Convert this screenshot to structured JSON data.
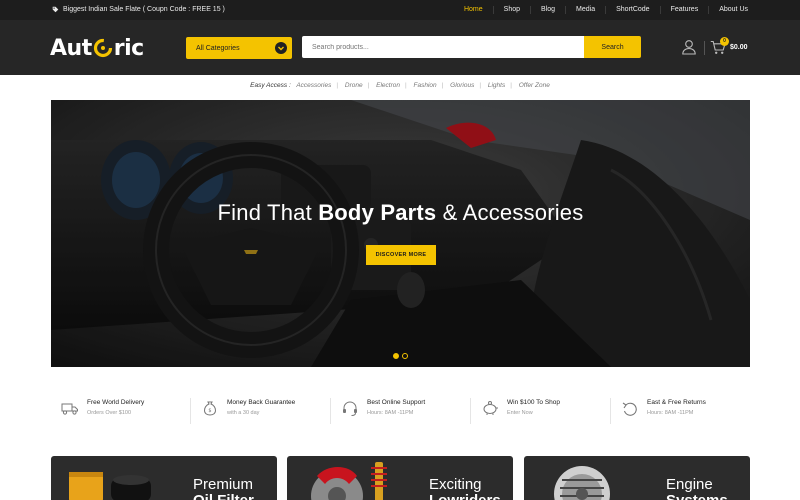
{
  "topbar": {
    "promo_text": "Biggest Indian Sale Flate ( Coupn Code : FREE 15 )",
    "nav": [
      "Home",
      "Shop",
      "Blog",
      "Media",
      "ShortCode",
      "Features",
      "About Us"
    ],
    "active_nav": "Home"
  },
  "header": {
    "logo_left": "Aut",
    "logo_right": "ric",
    "category_select": "All Categories",
    "search_placeholder": "Search products...",
    "search_button": "Search",
    "cart_count": "0",
    "cart_total": "$0.00"
  },
  "easy_access": {
    "label": "Easy Access :",
    "links": [
      "Accessories",
      "Drone",
      "Electron",
      "Fashion",
      "Glorious",
      "Lights",
      "Offer Zone"
    ]
  },
  "hero": {
    "title_pre": "Find That ",
    "title_bold": "Body Parts",
    "title_post": " & Accessories",
    "button": "DISCOVER MORE",
    "slide_count": 2,
    "active_slide": 1
  },
  "features": [
    {
      "title": "Free World Delivery",
      "subtitle": "Orders Over $100",
      "icon": "truck-icon"
    },
    {
      "title": "Money Back Guarantee",
      "subtitle": "with a 30 day",
      "icon": "money-bag-icon"
    },
    {
      "title": "Best Online Support",
      "subtitle": "Hours: 8AM -11PM",
      "icon": "headset-icon"
    },
    {
      "title": "Win $100 To Shop",
      "subtitle": "Enter Now",
      "icon": "piggy-bank-icon"
    },
    {
      "title": "East & Free Returns",
      "subtitle": "Hours: 8AM -11PM",
      "icon": "return-icon"
    }
  ],
  "promos": [
    {
      "line1": "Premium",
      "line2": "Oil Filter"
    },
    {
      "line1": "Exciting",
      "line2": "Lowriders"
    },
    {
      "line1": "Engine",
      "line2": "Systems"
    }
  ],
  "colors": {
    "accent": "#f4c300",
    "dark": "#262626",
    "topbar": "#1d1d1d"
  }
}
